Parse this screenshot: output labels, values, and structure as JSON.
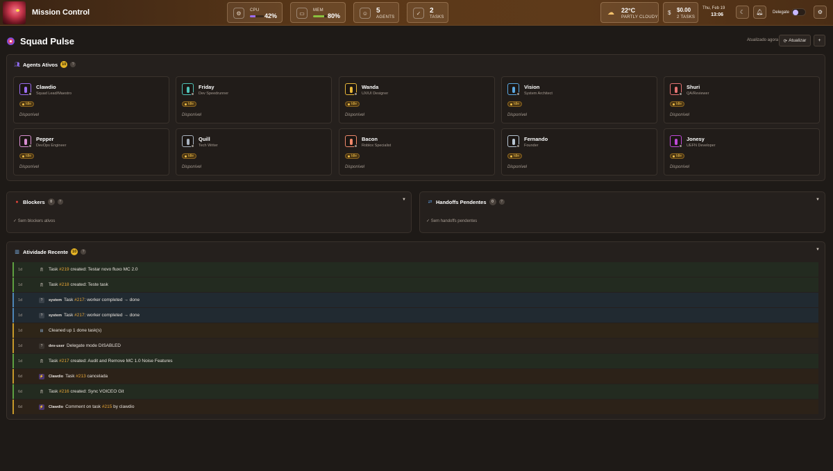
{
  "app": {
    "title": "Mission Control"
  },
  "stats": {
    "cpu": {
      "label": "CPU",
      "value": "42%",
      "level": 0.42,
      "color": "#9b6cf0"
    },
    "mem": {
      "label": "MEM",
      "value": "80%",
      "level": 0.8,
      "color": "#8ac13f"
    },
    "agents": {
      "value": "5",
      "label": "AGENTS"
    },
    "tasks": {
      "value": "2",
      "label": "TASKS"
    },
    "weather": {
      "temp": "22°C",
      "desc": "PARTLY CLOUDY"
    },
    "cost": {
      "value": "$0.00",
      "sub": "2 TASKS"
    }
  },
  "clock": {
    "date": "Thu, Feb 19",
    "time": "13:06"
  },
  "header_right": {
    "delegate_label": "Delegate"
  },
  "page": {
    "title": "Squad Pulse",
    "updated": "Atualizado agora",
    "refresh_label": "Atualizar",
    "plus": "+"
  },
  "agents_panel": {
    "title": "Agents Ativos",
    "count": "10",
    "help": "?"
  },
  "agents": [
    {
      "name": "Clawdio",
      "role": "Squad Lead/Maestro",
      "status": "Idle",
      "availability": "Disponível",
      "color": "#9b6cf0"
    },
    {
      "name": "Friday",
      "role": "Dev Speedrunner",
      "status": "Idle",
      "availability": "Disponível",
      "color": "#4fc3b8"
    },
    {
      "name": "Wanda",
      "role": "UX/UI Designer",
      "status": "Idle",
      "availability": "Disponível",
      "color": "#e8b73a"
    },
    {
      "name": "Vision",
      "role": "System Architect",
      "status": "Idle",
      "availability": "Disponível",
      "color": "#5aa7e0"
    },
    {
      "name": "Shuri",
      "role": "QA/Reviewer",
      "status": "Idle",
      "availability": "Disponível",
      "color": "#e57373"
    },
    {
      "name": "Pepper",
      "role": "DevOps Engineer",
      "status": "Idle",
      "availability": "Disponível",
      "color": "#d88ed0"
    },
    {
      "name": "Quill",
      "role": "Tech Writer",
      "status": "Idle",
      "availability": "Disponível",
      "color": "#aab4c0"
    },
    {
      "name": "Bacon",
      "role": "Roblox Specialist",
      "status": "Idle",
      "availability": "Disponível",
      "color": "#f08a6c"
    },
    {
      "name": "Fernando",
      "role": "Founder",
      "status": "Idle",
      "availability": "Disponível",
      "color": "#b8c6d4"
    },
    {
      "name": "Jonesy",
      "role": "UEFN Developer",
      "status": "Idle",
      "availability": "Disponível",
      "color": "#c04ad8"
    }
  ],
  "blockers": {
    "title": "Blockers",
    "count": "0",
    "help": "?",
    "empty": "✓ Sem blockers ativos"
  },
  "handoffs": {
    "title": "Handoffs Pendentes",
    "count": "0",
    "help": "?",
    "empty": "✓ Sem handoffs pendentes"
  },
  "activity": {
    "title": "Atividade Recente",
    "count": "10",
    "help": "?",
    "rows": [
      {
        "age": "1d",
        "who": "",
        "pre": "Task ",
        "ref": "#219",
        "post": " created: Testar novo fluxo MC 2.0",
        "kind": "task"
      },
      {
        "age": "1d",
        "who": "",
        "pre": "Task ",
        "ref": "#218",
        "post": " created: Teste task",
        "kind": "task"
      },
      {
        "age": "1d",
        "who": "system",
        "pre": "Task ",
        "ref": "#217",
        "post": ": worker completed → done",
        "kind": "system"
      },
      {
        "age": "1d",
        "who": "system",
        "pre": "Task ",
        "ref": "#217",
        "post": ": worker completed → done",
        "kind": "system"
      },
      {
        "age": "1d",
        "who": "",
        "pre": "Cleaned up 1 done task(s)",
        "ref": "",
        "post": "",
        "kind": "cleanup"
      },
      {
        "age": "1d",
        "who": "dev-user",
        "pre": "Delegate mode DISABLED",
        "ref": "",
        "post": "",
        "kind": "user"
      },
      {
        "age": "1d",
        "who": "",
        "pre": "Task ",
        "ref": "#217",
        "post": " created: Audit and Remove MC 1.0 Noise Features",
        "kind": "task"
      },
      {
        "age": "6d",
        "who": "Clawdio",
        "pre": "Task ",
        "ref": "#213",
        "post": " cancelada",
        "kind": "clawdio"
      },
      {
        "age": "6d",
        "who": "",
        "pre": "Task ",
        "ref": "#216",
        "post": " created: Sync VOICEO Git",
        "kind": "task"
      },
      {
        "age": "6d",
        "who": "Clawdio",
        "pre": "Comment on task ",
        "ref": "#215",
        "post": " by clawdio",
        "kind": "clawdio"
      }
    ]
  }
}
